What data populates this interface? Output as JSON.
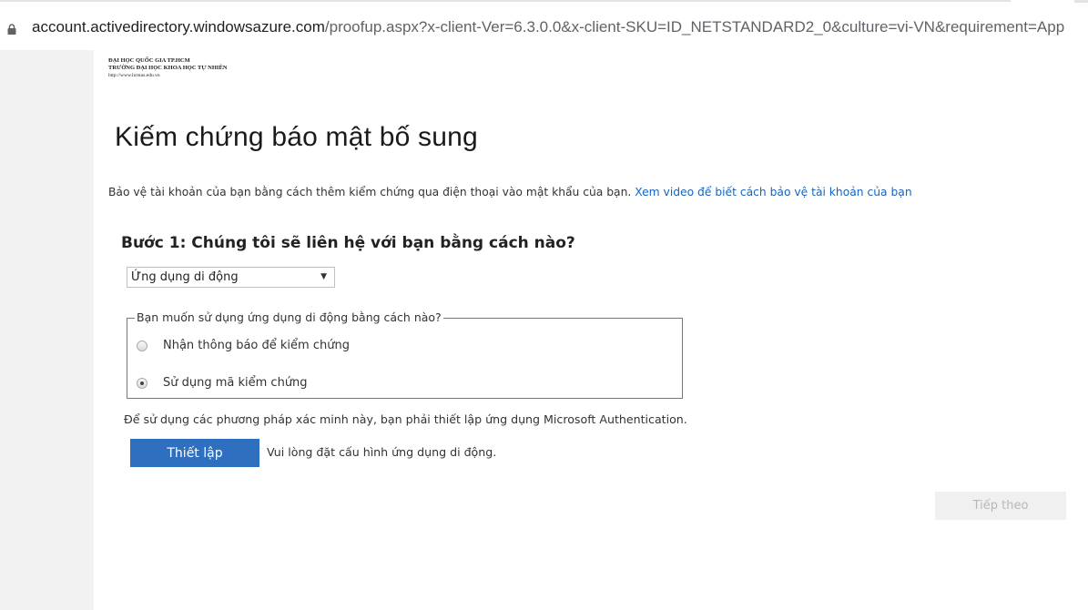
{
  "browser": {
    "url_host": "account.activedirectory.windowsazure.com",
    "url_path": "/proofup.aspx?x-client-Ver=6.3.0.0&x-client-SKU=ID_NETSTANDARD2_0&culture=vi-VN&requirement=App"
  },
  "org": {
    "line1": "ĐẠI HỌC QUỐC GIA TP.HCM",
    "line2": "TRƯỜNG ĐẠI HỌC KHOA HỌC TỰ NHIÊN",
    "line3": "http://www.hcmus.edu.vn"
  },
  "page": {
    "title": "Kiếm chứng báo mật bố sung",
    "intro_text": "Bảo vệ tài khoản của bạn bằng cách thêm kiểm chứng qua điện thoại vào mật khẩu của bạn.",
    "intro_link": "Xem video để biết cách bảo vệ tài khoản của bạn"
  },
  "step1": {
    "heading": "Bước 1: Chúng tôi sẽ liên hệ với bạn bằng cách nào?",
    "method_selected": "Ứng dụng di động",
    "fieldset_legend": "Bạn muốn sử dụng ứng dụng di động bằng cách nào?",
    "options": [
      {
        "label": "Nhận thông báo để kiểm chứng",
        "checked": false
      },
      {
        "label": "Sử dụng mã kiểm chứng",
        "checked": true
      }
    ],
    "auth_note": "Để sử dụng các phương pháp xác minh này, bạn phải thiết lập ứng dụng Microsoft Authentication.",
    "setup_label": "Thiết lập",
    "setup_hint": "Vui lòng đặt cấu hình ứng dụng di động."
  },
  "footer": {
    "next_label": "Tiếp theo"
  },
  "colors": {
    "primary_button": "#2f6fbf",
    "link": "#1565c0",
    "disabled_button": "#f0f0f0"
  }
}
